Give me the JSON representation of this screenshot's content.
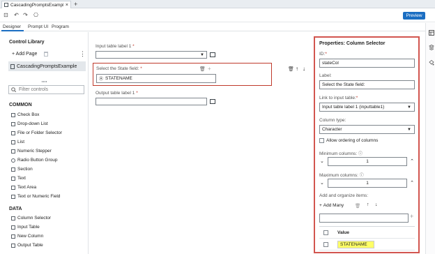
{
  "file_tab": {
    "name": "CascadingPromptsExample.step",
    "close": "×"
  },
  "tab_add": "+",
  "toolbar": {
    "save_icon": "⊡",
    "undo_icon": "↶",
    "redo_icon": "↷",
    "other_icon": "⎔",
    "preview_label": "Preview"
  },
  "mode_tabs": [
    "Designer",
    "Prompt UI",
    "Program"
  ],
  "library": {
    "title": "Control Library",
    "add_page": "+ Add Page",
    "kebab": "⋮",
    "page_item": "CascadingPromptsExample",
    "filter_placeholder": "Filter controls",
    "common_label": "COMMON",
    "common_items": [
      "Check Box",
      "Drop-down List",
      "File or Folder Selector",
      "List",
      "Numeric Stepper",
      "Radio Button Group",
      "Section",
      "Text",
      "Text Area",
      "Text or Numeric Field"
    ],
    "data_label": "DATA",
    "data_items": [
      "Column Selector",
      "Input Table",
      "New Column",
      "Output Table"
    ]
  },
  "canvas": {
    "input_label": "Input table label 1",
    "select_label": "Select the State field:",
    "column_chip": "STATENAME",
    "output_label": "Output table label 1",
    "required_star": "*"
  },
  "props": {
    "title": "Properties: Column Selector",
    "id_label": "ID:",
    "id_value": "stateCol",
    "label_label": "Label:",
    "label_value": "Select the State field:",
    "link_label": "Link to input table:",
    "link_value": "Input table label 1 (inputtable1)",
    "coltype_label": "Column type:",
    "coltype_value": "Character",
    "allow_ordering": "Allow ordering of columns",
    "min_label": "Minimum columns:",
    "min_value": "1",
    "max_label": "Maximum columns:",
    "max_value": "1",
    "add_items_label": "Add and organize items:",
    "add_many": "Add Many",
    "plus": "+",
    "up_arrow": "↑",
    "down_arrow": "↓",
    "value_header": "Value",
    "value_item": "STATENAME",
    "required_star": "*"
  },
  "colors": {
    "accent": "#1b6ec2",
    "highlight_border": "#d2554f",
    "value_highlight": "#ffff66"
  }
}
